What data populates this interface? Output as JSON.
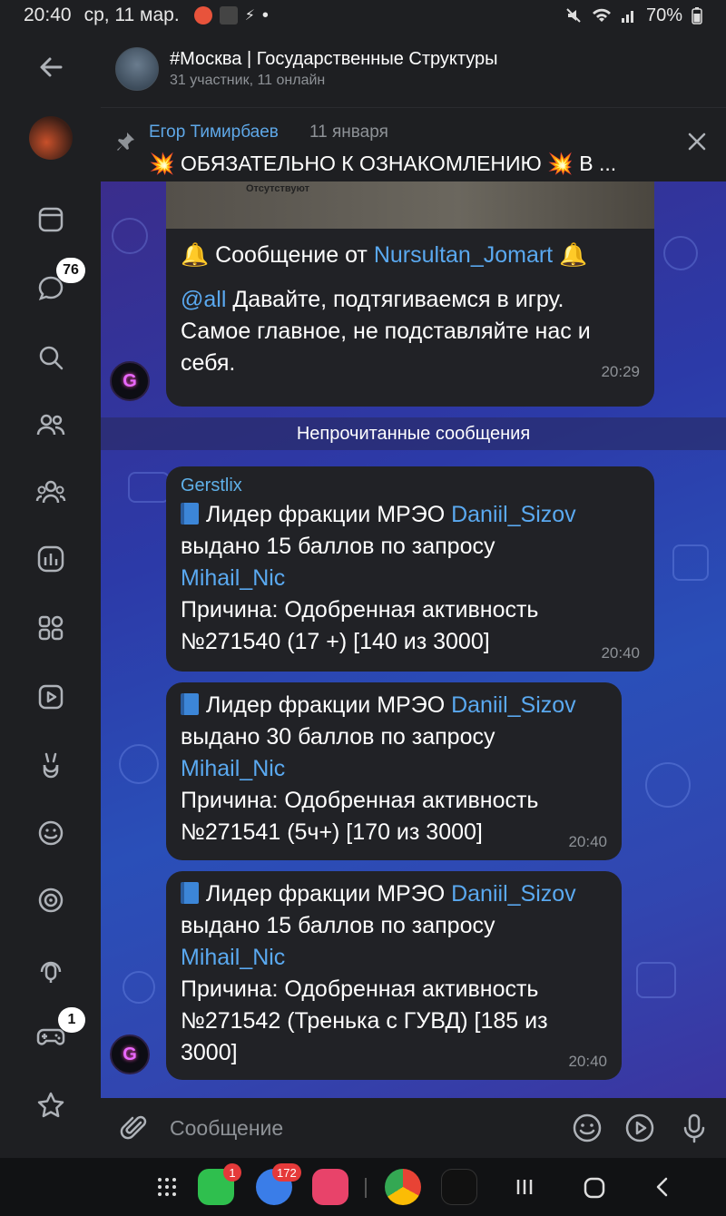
{
  "status_bar": {
    "time": "20:40",
    "date": "ср, 11 мар.",
    "battery": "70%"
  },
  "rail": {
    "chats_badge": "76",
    "games_badge": "1"
  },
  "header": {
    "title": "#Москва | Государственные Структуры",
    "subtitle": "31 участник, 11 онлайн"
  },
  "pinned": {
    "author": "Егор Тимирбаев",
    "date": "11 января",
    "text": "💥 ОБЯЗАТЕЛЬНО К ОЗНАКОМЛЕНИЮ 💥 В ..."
  },
  "messages": {
    "first": {
      "image_caption": "Отсутствуют",
      "line1_prefix": "🔔 Сообщение от ",
      "line1_link": "Nursultan_Jomart",
      "line1_suffix": " 🔔",
      "mention": "@all",
      "line2_rest": " Давайте, подтягиваемся в игру.",
      "line3": "Самое главное, не подставляйте нас и",
      "line4": "себя.",
      "time": "20:29"
    },
    "unread_label": "Непрочитанные сообщения",
    "m1": {
      "author": "Gerstlix",
      "prefix": "Лидер фракции МРЭО ",
      "link1": "Daniil_Sizov",
      "line2": "выдано 15 баллов по запросу",
      "link2": "Mihail_Nic",
      "line4": "Причина: Одобренная активность",
      "line5": "№271540 (17 +) [140 из 3000]",
      "time": "20:40"
    },
    "m2": {
      "prefix": "Лидер фракции МРЭО ",
      "link1": "Daniil_Sizov",
      "line2": "выдано 30 баллов по запросу",
      "link2": "Mihail_Nic",
      "line4": "Причина: Одобренная активность",
      "line5": "№271541 (5ч+) [170 из 3000]",
      "time": "20:40"
    },
    "m3": {
      "prefix": "Лидер фракции МРЭО ",
      "link1": "Daniil_Sizov",
      "line2": "выдано 15 баллов по запросу",
      "link2": "Mihail_Nic",
      "line4": "Причина: Одобренная активность",
      "line5": "№271542 (Тренька с ГУВД) [185 из",
      "line6": "3000]",
      "time": "20:40"
    }
  },
  "input": {
    "placeholder": "Сообщение"
  },
  "navbar": {
    "phone_badge": "1",
    "messages_badge": "172"
  },
  "colors": {
    "accent": "#5fa8e8",
    "bubble": "#212226",
    "background": "#1e1f22"
  }
}
